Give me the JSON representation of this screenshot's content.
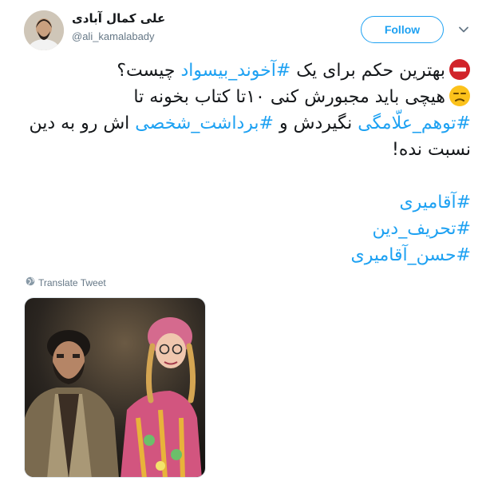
{
  "tweet": {
    "display_name": "علی کمال آبادی",
    "handle": "@ali_kamalabady",
    "follow_label": "Follow",
    "translate_label": "Translate Tweet",
    "line1": {
      "pre": "بهترین حکم برای یک ",
      "tag": "#آخوند_بیسواد",
      "post": " چیست؟"
    },
    "line2": {
      "text": "هیچی باید مجبورش کنی ۱۰تا کتاب بخونه تا"
    },
    "line3": {
      "tag1": "#توهم_علّامگی",
      "mid": " نگیردش و ",
      "tag2": "#برداشت_شخصی",
      "post": " اش رو به دین"
    },
    "line4": {
      "text": "نسبت نده!"
    },
    "hashtags": [
      "#آقامیری",
      "#تحریف_دین",
      "#حسن_آقامیری"
    ]
  },
  "icons": {
    "no_entry": "no-entry-emoji",
    "unamused": "unamused-face-emoji",
    "globe": "globe-icon",
    "caret": "chevron-down-icon"
  },
  "colors": {
    "accent": "#1da1f2",
    "text": "#14171a",
    "muted": "#657786"
  }
}
